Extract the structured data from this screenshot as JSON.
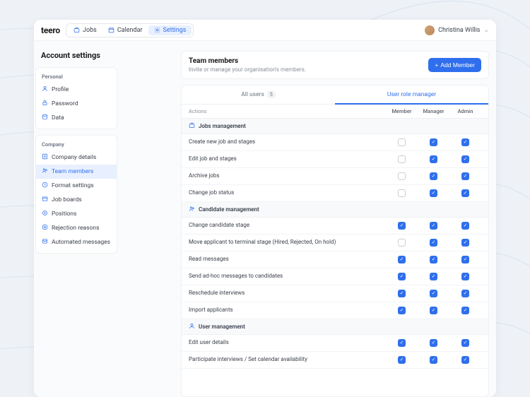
{
  "brand": "teero",
  "nav": {
    "jobs": "Jobs",
    "calendar": "Calendar",
    "settings": "Settings"
  },
  "user": {
    "name": "Christina Willis"
  },
  "page_title": "Account settings",
  "sidebar": {
    "personal_label": "Personal",
    "personal": [
      {
        "label": "Profile"
      },
      {
        "label": "Password"
      },
      {
        "label": "Data"
      }
    ],
    "company_label": "Company",
    "company": [
      {
        "label": "Company details"
      },
      {
        "label": "Team members"
      },
      {
        "label": "Format settings"
      },
      {
        "label": "Job boards"
      },
      {
        "label": "Positions"
      },
      {
        "label": "Rejection reasons"
      },
      {
        "label": "Automated messages"
      }
    ]
  },
  "header": {
    "title": "Team members",
    "subtitle": "Invite or manage your organisation's members.",
    "add_btn": "Add Member"
  },
  "tabs": {
    "all_users": "All users",
    "all_users_count": "5",
    "role_manager": "User role manager"
  },
  "cols": {
    "actions": "Actions",
    "member": "Member",
    "manager": "Manager",
    "admin": "Admin"
  },
  "groups": [
    {
      "title": "Jobs management",
      "rows": [
        {
          "label": "Create new job and stages",
          "member": false,
          "manager": true,
          "admin": true
        },
        {
          "label": "Edit job and stages",
          "member": false,
          "manager": true,
          "admin": true
        },
        {
          "label": "Archive jobs",
          "member": false,
          "manager": true,
          "admin": true
        },
        {
          "label": "Change job status",
          "member": false,
          "manager": true,
          "admin": true
        }
      ]
    },
    {
      "title": "Candidate management",
      "rows": [
        {
          "label": "Change candidate stage",
          "member": true,
          "manager": true,
          "admin": true
        },
        {
          "label": "Move applicant to terminal stage (Hired, Rejected, On hold)",
          "member": false,
          "manager": true,
          "admin": true
        },
        {
          "label": "Read messages",
          "member": true,
          "manager": true,
          "admin": true
        },
        {
          "label": "Send ad-hoc messages to candidates",
          "member": true,
          "manager": true,
          "admin": true
        },
        {
          "label": "Reschedule interviews",
          "member": true,
          "manager": true,
          "admin": true
        },
        {
          "label": "Import applicants",
          "member": true,
          "manager": true,
          "admin": true
        }
      ]
    },
    {
      "title": "User management",
      "rows": [
        {
          "label": "Edit user details",
          "member": true,
          "manager": true,
          "admin": true
        },
        {
          "label": "Participate interviews / Set calendar availability",
          "member": true,
          "manager": true,
          "admin": true
        }
      ]
    }
  ]
}
